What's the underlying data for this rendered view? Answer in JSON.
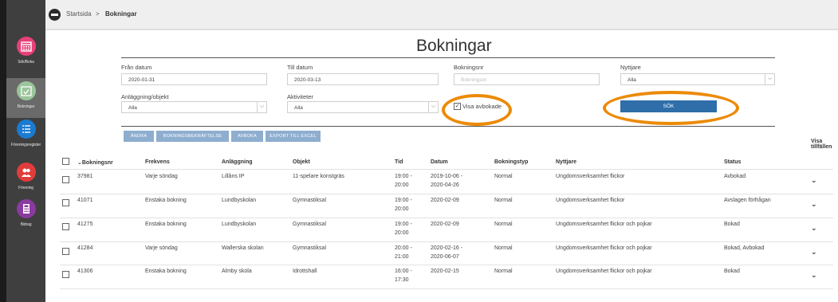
{
  "breadcrumb": {
    "home": "Startsida",
    "separator": ">",
    "current": "Bokningar"
  },
  "sidebar": {
    "items": [
      {
        "label": "Sök/Boka",
        "icon": "calendar-icon",
        "color": "#e6417a"
      },
      {
        "label": "Bokningar",
        "icon": "calendar-check-icon",
        "color": "#9bc59a"
      },
      {
        "label": "Föreningsregister",
        "icon": "list-icon",
        "color": "#1a7bd1"
      },
      {
        "label": "Förening",
        "icon": "users-icon",
        "color": "#e13c3c"
      },
      {
        "label": "Bidrag",
        "icon": "calculator-icon",
        "color": "#8b3aa0"
      }
    ]
  },
  "page": {
    "title": "Bokningar"
  },
  "filters": {
    "from_label": "Från datum",
    "from_value": "2020-01-31",
    "to_label": "Till datum",
    "to_value": "2020-03-13",
    "bookingnr_label": "Bokningsnr",
    "bookingnr_placeholder": "Bokningsnr",
    "user_label": "Nyttjare",
    "user_value": "Alla",
    "facility_label": "Anläggning/objekt",
    "facility_value": "Alla",
    "activity_label": "Aktiviteter",
    "activity_value": "Alla",
    "show_cancelled_label": "Visa avbokade",
    "search_label": "SÖK"
  },
  "actions": {
    "change": "ÄNDRA",
    "confirm": "BOKNINGSBEKRÄFTELSE",
    "cancel": "AVBOKA",
    "export": "EXPORT TILL EXCEL"
  },
  "table": {
    "headers": {
      "bookingnr": "Bokningsnr",
      "frequency": "Frekvens",
      "facility": "Anläggning",
      "object": "Objekt",
      "time": "Tid",
      "date": "Datum",
      "type": "Bokningstyp",
      "user": "Nyttjare",
      "status": "Status",
      "show_occasions_1": "Visa",
      "show_occasions_2": "tillfällen"
    },
    "rows": [
      {
        "nr": "37981",
        "freq": "Varje söndag",
        "facility": "Lillåns IP",
        "object": "11-spelare konstgräs",
        "time1": "19:00 -",
        "time2": "20:00",
        "date1": "2019-10-06 -",
        "date2": "2020-04-26",
        "type": "Normal",
        "user": "Ungdomsverksamhet flickor",
        "status": "Avbokad"
      },
      {
        "nr": "41071",
        "freq": "Enstaka bokning",
        "facility": "Lundbyskolan",
        "object": "Gymnastiksal",
        "time1": "19:00 -",
        "time2": "20:00",
        "date1": "2020-02-09",
        "date2": "",
        "type": "Normal",
        "user": "Ungdomsverksamhet flickor",
        "status": "Avslagen förfrågan"
      },
      {
        "nr": "41275",
        "freq": "Enstaka bokning",
        "facility": "Lundbyskolan",
        "object": "Gymnastiksal",
        "time1": "19:00 -",
        "time2": "20:00",
        "date1": "2020-02-09",
        "date2": "",
        "type": "Normal",
        "user": "Ungdomsverksamhet flickor och pojkar",
        "status": "Bokad"
      },
      {
        "nr": "41284",
        "freq": "Varje söndag",
        "facility": "Wallerska skolan",
        "object": "Gymnastiksal",
        "time1": "20:00 -",
        "time2": "21:00",
        "date1": "2020-02-16 -",
        "date2": "2020-06-07",
        "type": "Normal",
        "user": "Ungdomsverksamhet flickor och pojkar",
        "status": "Bokad, Avbokad"
      },
      {
        "nr": "41306",
        "freq": "Enstaka bokning",
        "facility": "Almby skola",
        "object": "Idrottshall",
        "time1": "16:00 -",
        "time2": "17:30",
        "date1": "2020-02-15",
        "date2": "",
        "type": "Normal",
        "user": "Ungdomsverksamhet flickor och pojkar",
        "status": "Bokad"
      }
    ]
  },
  "colors": {
    "accent": "#2f6ea9",
    "action_button": "#8eaed0",
    "highlight_oval": "#ec8a06"
  }
}
